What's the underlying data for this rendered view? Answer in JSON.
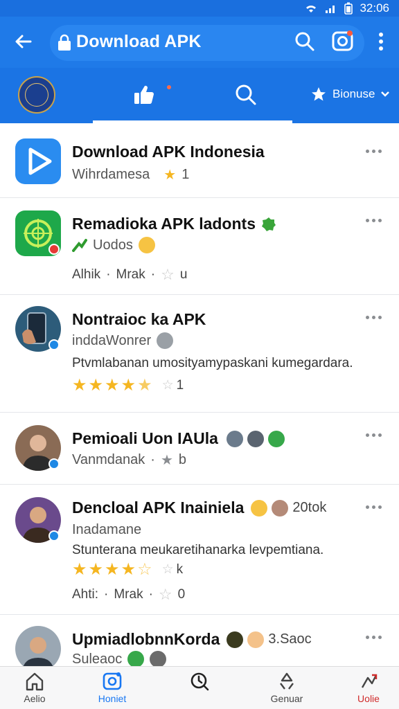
{
  "status_bar": {
    "time": "32:06"
  },
  "app_bar": {
    "title": "Download APK"
  },
  "tab_bar": {
    "favorites_label": "Bionuse"
  },
  "items": [
    {
      "name": "Download APK Indonesia",
      "subtitle": "Wihrdamesa",
      "rating_count": "1"
    },
    {
      "name": "Remadioka APK ladonts",
      "subtitle": "Uodos",
      "meta_left": "Alhik",
      "meta_mid": "Mrak",
      "meta_count": "u"
    },
    {
      "name": "Nontraioc ka APK",
      "subtitle": "inddaWonrer",
      "description": "Ptvmlabanan umosityamypaskani kumegardara.",
      "rating": 4.5,
      "rating_count": "1"
    },
    {
      "name": "Pemioali Uon IAUla",
      "subtitle": "Vanmdanak",
      "rating_count": "b"
    },
    {
      "name": "Dencloal APK Inainiela",
      "name_suffix": "20tok",
      "subtitle": "Inadamane",
      "description": "Stunterana meukaretihanarka levpemtiana.",
      "rating": 4.5,
      "rating_count": "k",
      "meta_left": "Ahti:",
      "meta_mid": "Mrak",
      "meta_count": "0"
    },
    {
      "name": "UpmiadlobnnKorda",
      "name_suffix": "3.Saoc",
      "subtitle": "Suleaoc"
    }
  ],
  "bottom_nav": [
    {
      "label": "Aelio",
      "icon": "home-icon"
    },
    {
      "label": "Honiet",
      "icon": "instagram-icon",
      "active": true
    },
    {
      "label": "",
      "icon": "clock-search-icon"
    },
    {
      "label": "Genuar",
      "icon": "recycle-icon"
    },
    {
      "label": "Uolie",
      "icon": "share-icon"
    }
  ],
  "colors": {
    "primary": "#1f7ae8",
    "star": "#f5b621",
    "active": "#1877f2"
  }
}
